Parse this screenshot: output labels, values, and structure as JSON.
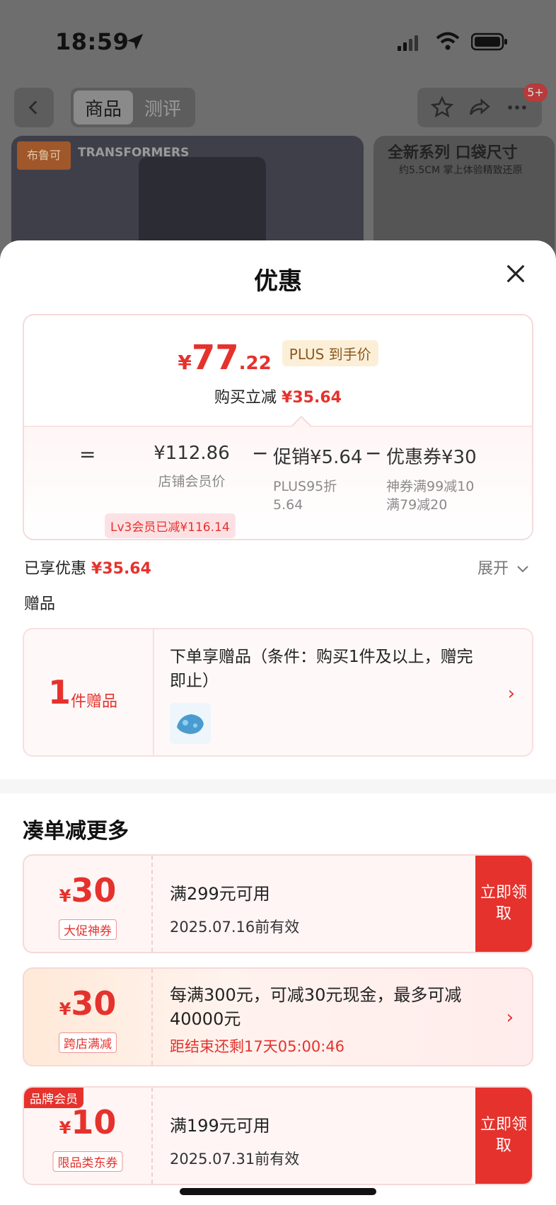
{
  "status_bar": {
    "time": "18:59"
  },
  "nav": {
    "tabs": [
      {
        "label": "商品",
        "active": true
      },
      {
        "label": "测评",
        "active": false
      }
    ],
    "badge": "5+"
  },
  "product": {
    "brand": "TRANSFORMERS",
    "side_title": "全新系列 口袋尺寸",
    "side_sub": "约5.5CM 掌上体验精致还原"
  },
  "sheet": {
    "title": "优惠",
    "price": {
      "yen": "¥",
      "int": "77",
      "dec": ".22",
      "plus_tag": "PLUS 到手价",
      "sub_label": "购买立减",
      "sub_value": "¥35.64"
    },
    "calc": {
      "eq": "=",
      "base_value": "¥112.86",
      "base_label": "店铺会员价",
      "lv_tag": "Lv3会员已减¥116.14",
      "minus": "−",
      "promo_value": "促销¥5.64",
      "promo_detail_1": "PLUS95折",
      "promo_detail_2": "5.64",
      "coupon_value": "优惠券¥30",
      "coupon_detail_1": "神券满99减10",
      "coupon_detail_2": "满79减20"
    },
    "enjoyed_label": "已享优惠",
    "enjoyed_value": "¥35.64",
    "expand_label": "展开",
    "gift_section": "赠品",
    "gift": {
      "count": "1",
      "unit": "件赠品",
      "text": "下单享赠品（条件：购买1件及以上，赠完即止）"
    },
    "more_title": "凑单减更多",
    "coupons": [
      {
        "yen": "¥",
        "amount": "30",
        "tag": "大促神券",
        "line1": "满299元可用",
        "line2": "2025.07.16前有效",
        "claim": "立即领取"
      },
      {
        "yen": "¥",
        "amount": "30",
        "tag": "跨店满减",
        "line1": "每满300元，可减30元现金，最多可减40000元",
        "line2": "距结束还剩17天05:00:46"
      },
      {
        "badge": "品牌会员",
        "yen": "¥",
        "amount": "10",
        "tag": "限品类东券",
        "line1": "满199元可用",
        "line2": "2025.07.31前有效",
        "claim": "立即领取"
      }
    ]
  },
  "colors": {
    "accent": "#e5322d",
    "plus_tag_bg": "#fcefd8"
  }
}
